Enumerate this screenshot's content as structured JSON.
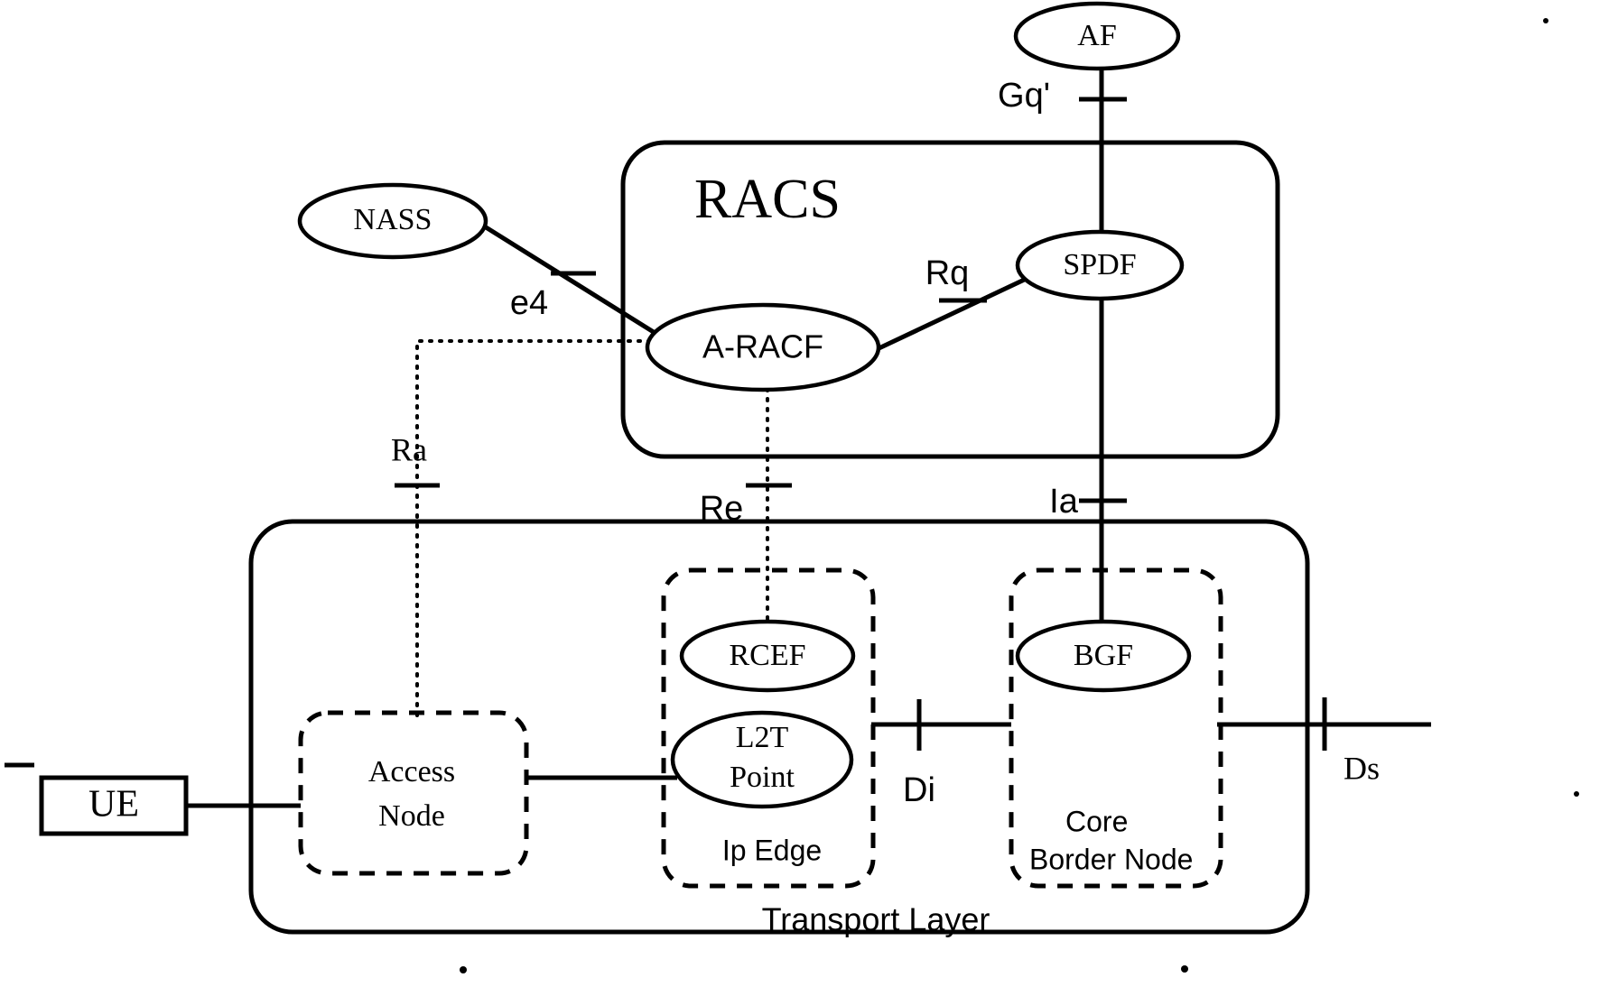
{
  "diagram": {
    "title_group": "RACS",
    "transport_group": "Transport Layer",
    "nodes": {
      "af": "AF",
      "nass": "NASS",
      "spdf": "SPDF",
      "aracf": "A-RACF",
      "rcef": "RCEF",
      "l2t_line1": "L2T",
      "l2t_line2": "Point",
      "bgf": "BGF",
      "access_line1": "Access",
      "access_line2": "Node",
      "ue": "UE",
      "ip_edge": "Ip Edge",
      "core_border_line1": "Core",
      "core_border_line2": "Border Node"
    },
    "reference_points": {
      "gq": "Gq'",
      "e4": "e4",
      "rq": "Rq",
      "ra": "Ra",
      "re": "Re",
      "ia": "Ia",
      "di": "Di",
      "ds": "Ds"
    },
    "colors": {
      "stroke": "#000000",
      "background": "#ffffff"
    }
  }
}
